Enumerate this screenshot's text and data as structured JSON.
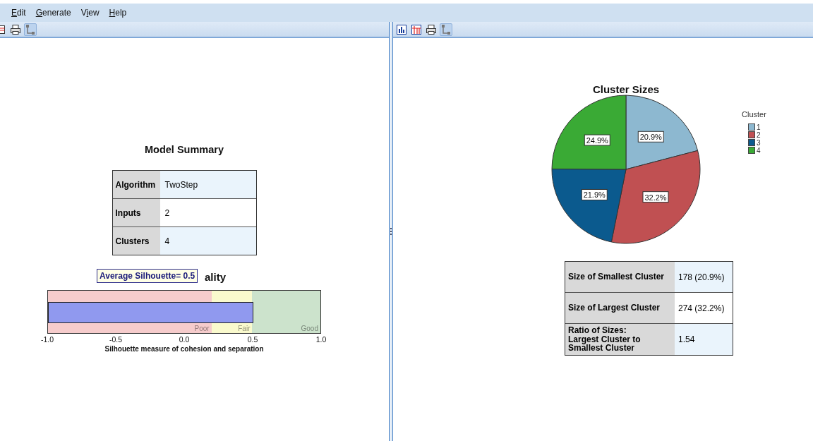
{
  "menu": [
    {
      "key": "E",
      "post": "dit"
    },
    {
      "key": "G",
      "post": "enerate"
    },
    {
      "pre": "V",
      "key": "i",
      "post": "ew"
    },
    {
      "key": "H",
      "post": "elp"
    }
  ],
  "left_pane": {
    "toolbar": [
      {
        "kind": "table",
        "pressed": false
      },
      {
        "kind": "print",
        "pressed": false
      },
      {
        "kind": "tree",
        "pressed": true
      }
    ],
    "model_summary": {
      "title": "Model Summary",
      "rows": [
        {
          "label": "Algorithm",
          "value": "TwoStep",
          "shaded": true
        },
        {
          "label": "Inputs",
          "value": "2",
          "shaded": false
        },
        {
          "label": "Clusters",
          "value": "4",
          "shaded": true
        }
      ]
    },
    "cluster_quality": {
      "title_visible": "ality",
      "tooltip": "Average Silhouette= 0.5",
      "meter": {
        "level": 0.755,
        "axis_label": "Silhouette measure of cohesion and separation",
        "ticks": [
          "-1.0",
          "-0.5",
          "0.0",
          "0.5",
          "1.0"
        ],
        "zones": [
          {
            "label": "Poor",
            "color": "#f6cccc",
            "level": 0.6
          },
          {
            "label": "Fair",
            "color": "#fafacd",
            "level": 0.75
          },
          {
            "label": "Good",
            "color": "#cce3cc",
            "level": 1
          }
        ]
      }
    }
  },
  "right_pane": {
    "toolbar": [
      {
        "kind": "chart",
        "pressed": false
      },
      {
        "kind": "grid",
        "pressed": false
      },
      {
        "kind": "print",
        "pressed": false
      },
      {
        "kind": "tree",
        "pressed": true
      }
    ],
    "cluster_sizes": {
      "chart_data": {
        "type": "pie",
        "title": "Cluster Sizes",
        "legend": "right",
        "categories": [
          "1",
          "2",
          "3",
          "4"
        ],
        "series": [
          {
            "name": "Cluster",
            "values": [
              20.9,
              32.2,
              21.9,
              24.9
            ]
          }
        ],
        "colors": [
          "#8db8d0",
          "#c05052",
          "#0b5a8e",
          "#3aaa35"
        ],
        "value_labels": [
          "20.9%",
          "32.2%",
          "21.9%",
          "24.9%"
        ]
      }
    },
    "size_table": [
      {
        "label": "Size of Smallest Cluster",
        "value": "178 (20.9%)",
        "shaded": true
      },
      {
        "label": "Size of Largest Cluster",
        "value": "274 (32.2%)",
        "shaded": false
      },
      {
        "label": "Ratio of Sizes:\nLargest Cluster to\nSmallest Cluster",
        "value": "1.54",
        "shaded": true
      }
    ]
  }
}
